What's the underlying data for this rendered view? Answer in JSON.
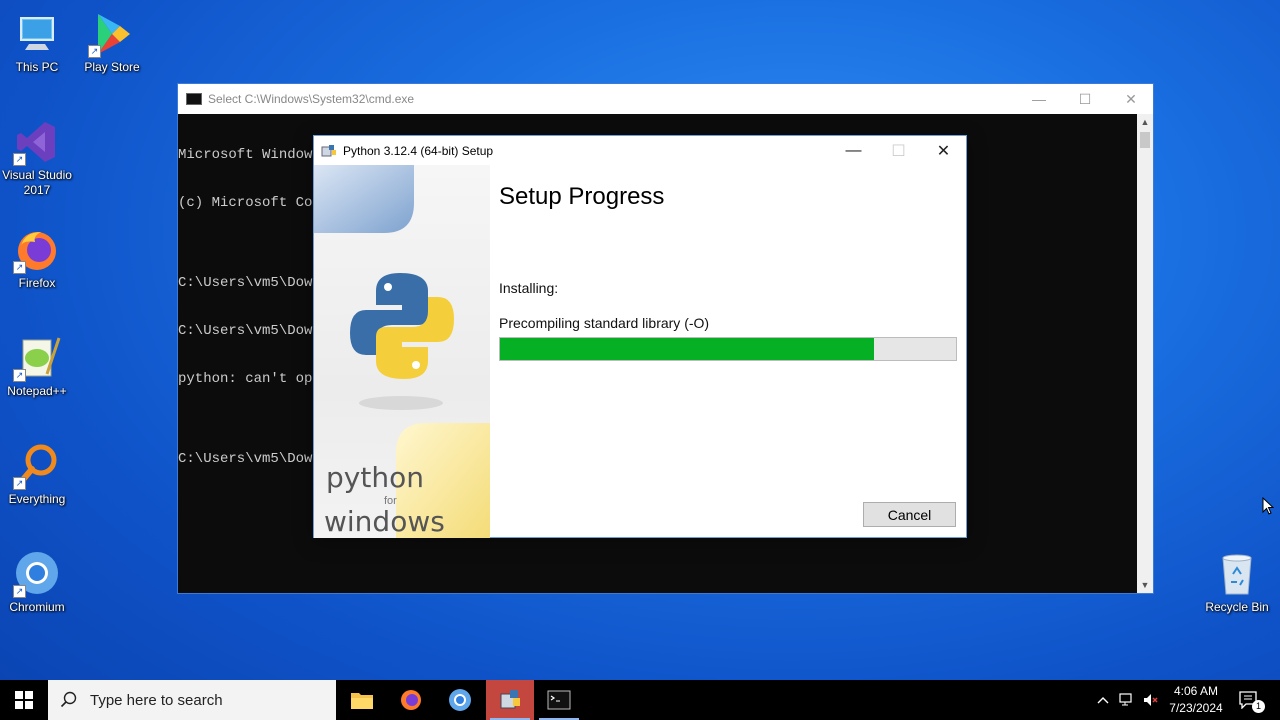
{
  "desktop": {
    "icons": [
      {
        "label": "This PC"
      },
      {
        "label": "Play Store"
      },
      {
        "label": "Visual Studio 2017"
      },
      {
        "label": "Firefox"
      },
      {
        "label": "Notepad++"
      },
      {
        "label": "Everything"
      },
      {
        "label": "Chromium"
      },
      {
        "label": "Recycle Bin"
      }
    ]
  },
  "cmd": {
    "title": "Select C:\\Windows\\System32\\cmd.exe",
    "lines": [
      "Microsoft Windows [Version 10.0.19045.4291]",
      "(c) Microsoft Cor",
      "",
      "C:\\Users\\vm5\\Down",
      "C:\\Users\\vm5\\Down",
      "python: can't ope",
      "",
      "C:\\Users\\vm5\\Down"
    ]
  },
  "setup": {
    "title": "Python 3.12.4 (64-bit) Setup",
    "heading": "Setup Progress",
    "installing_label": "Installing:",
    "step_label": "Precompiling standard library (-O)",
    "progress": 0.82,
    "cancel_label": "Cancel",
    "brand_line1": "python",
    "brand_line2": "for",
    "brand_line3": "windows"
  },
  "taskbar": {
    "search_placeholder": "Type here to search",
    "clock_time": "4:06 AM",
    "clock_date": "7/23/2024",
    "notification_count": "1"
  },
  "colors": {
    "progress_fill": "#06b025",
    "desktop_bg": "#1a6fe0"
  }
}
